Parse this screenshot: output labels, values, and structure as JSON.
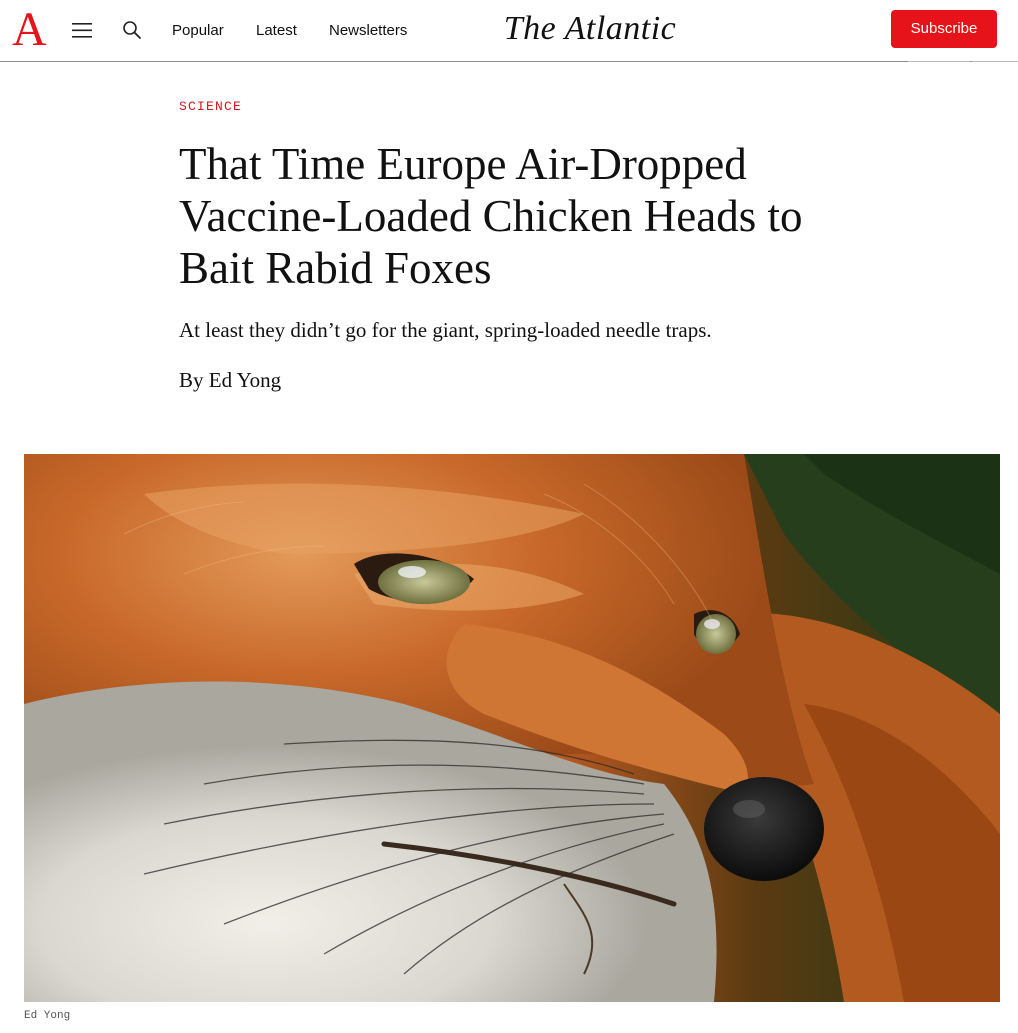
{
  "header": {
    "logo_letter": "A",
    "nav": {
      "popular": "Popular",
      "latest": "Latest",
      "newsletters": "Newsletters"
    },
    "brand": "The Atlantic",
    "subscribe_label": "Subscribe",
    "icons": [
      "menu-icon",
      "search-icon"
    ],
    "accent_color": "#e7131a"
  },
  "article": {
    "section": "SCIENCE",
    "headline": "That Time Europe Air-Dropped Vaccine-Loaded Chicken Heads to Bait Rabid Foxes",
    "dek": "At least they didn’t go for the giant, spring-loaded needle traps.",
    "byline_prefix": "By",
    "author": "Ed Yong",
    "image_credit": "Ed Yong"
  }
}
